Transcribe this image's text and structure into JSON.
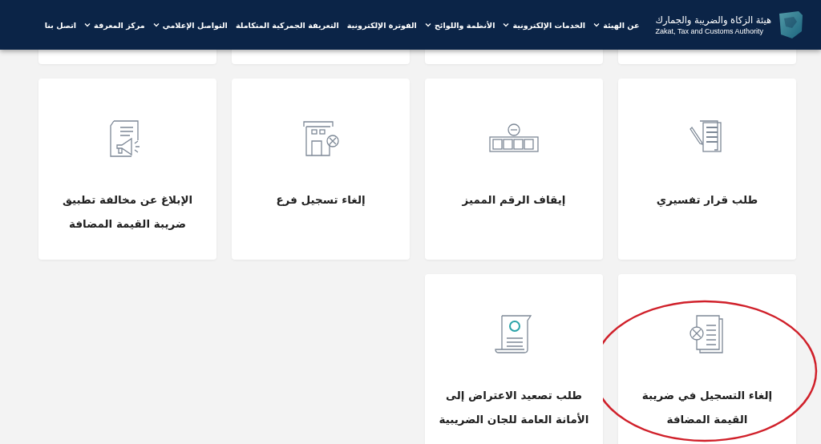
{
  "header": {
    "logo": {
      "title_ar": "هيئة الزكاة والضريبة والجمارك",
      "title_en": "Zakat, Tax and Customs Authority"
    },
    "nav": [
      {
        "label": "عن الهيئة",
        "has_dropdown": true
      },
      {
        "label": "الخدمات الإلكترونية",
        "has_dropdown": true
      },
      {
        "label": "الأنظمة واللوائح",
        "has_dropdown": true
      },
      {
        "label": "الفوترة الإلكترونية",
        "has_dropdown": false
      },
      {
        "label": "التعريفة الجمركية المتكاملة",
        "has_dropdown": false
      },
      {
        "label": "التواصل الإعلامي",
        "has_dropdown": true
      },
      {
        "label": "مركز المعرفة",
        "has_dropdown": true
      },
      {
        "label": "اتصل بنا",
        "has_dropdown": false
      }
    ]
  },
  "services": [
    {
      "title": "طلب قرار تفسيري",
      "kind": "document-pen",
      "highlighted": false
    },
    {
      "title": "إيقاف الرقم المميز",
      "kind": "number-minus",
      "highlighted": false
    },
    {
      "title": "إلغاء تسجيل فرع",
      "kind": "building-cancel",
      "highlighted": false
    },
    {
      "title": "الإبلاغ عن مخالفة تطبيق ضريبة القيمة المضافة",
      "kind": "document-megaphone",
      "highlighted": false
    },
    {
      "title": "إلغاء التسجيل في ضريبة القيمة المضافة",
      "kind": "document-cancel",
      "highlighted": true
    },
    {
      "title": "طلب تصعيد الاعتراض إلى الأمانة العامة للجان الضريبية",
      "kind": "scroll-seal",
      "highlighted": false
    }
  ]
}
